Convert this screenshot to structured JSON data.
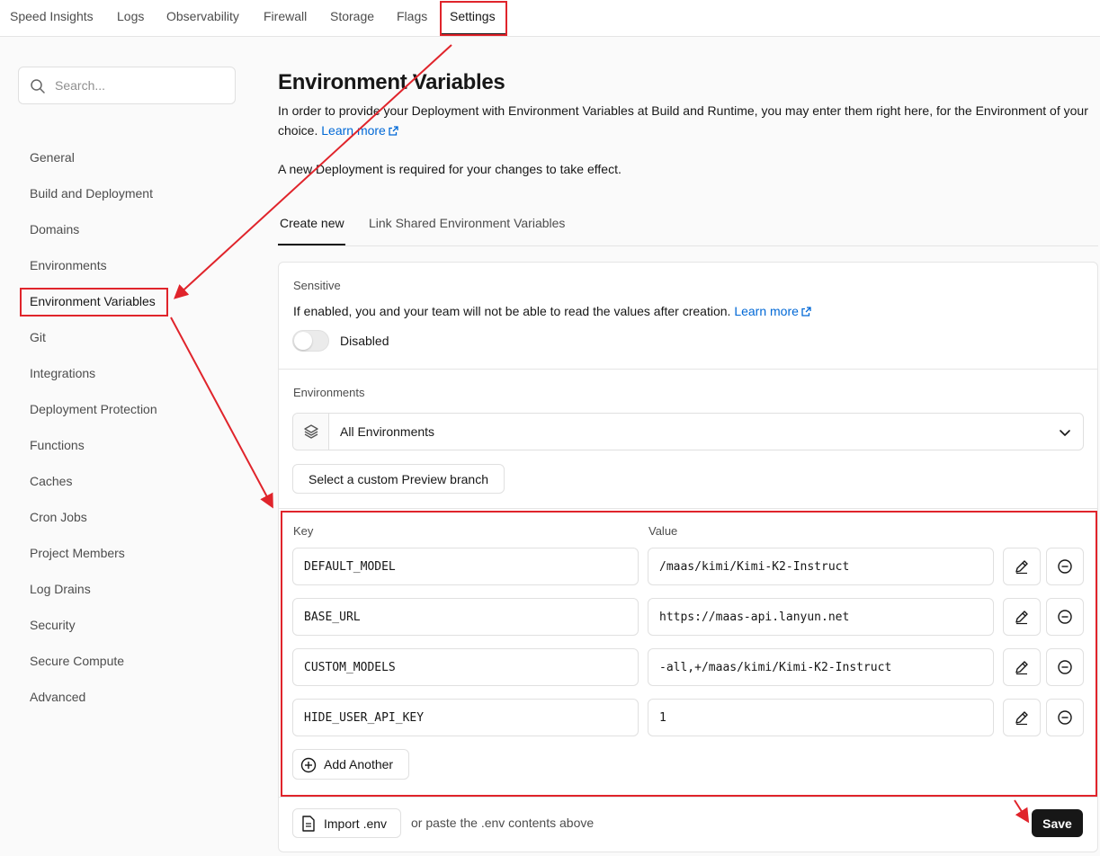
{
  "top_nav": {
    "tabs": [
      "Speed Insights",
      "Logs",
      "Observability",
      "Firewall",
      "Storage",
      "Flags",
      "Settings"
    ],
    "active": "Settings"
  },
  "sidebar": {
    "search_placeholder": "Search...",
    "items": [
      "General",
      "Build and Deployment",
      "Domains",
      "Environments",
      "Environment Variables",
      "Git",
      "Integrations",
      "Deployment Protection",
      "Functions",
      "Caches",
      "Cron Jobs",
      "Project Members",
      "Log Drains",
      "Security",
      "Secure Compute",
      "Advanced"
    ],
    "active": "Environment Variables"
  },
  "main": {
    "title": "Environment Variables",
    "description": "In order to provide your Deployment with Environment Variables at Build and Runtime, you may enter them right here, for the Environment of your choice.",
    "learn_more": "Learn more",
    "note": "A new Deployment is required for your changes to take effect.",
    "tabs": [
      "Create new",
      "Link Shared Environment Variables"
    ],
    "active_tab": "Create new",
    "sensitive": {
      "label": "Sensitive",
      "description": "If enabled, you and your team will not be able to read the values after creation.",
      "learn_more": "Learn more",
      "toggle_state": "Disabled"
    },
    "environments": {
      "label": "Environments",
      "selected": "All Environments",
      "custom_branch_button": "Select a custom Preview branch"
    },
    "variables": {
      "key_header": "Key",
      "value_header": "Value",
      "rows": [
        {
          "key": "DEFAULT_MODEL",
          "value": "/maas/kimi/Kimi-K2-Instruct"
        },
        {
          "key": "BASE_URL",
          "value": "https://maas-api.lanyun.net"
        },
        {
          "key": "CUSTOM_MODELS",
          "value": "-all,+/maas/kimi/Kimi-K2-Instruct"
        },
        {
          "key": "HIDE_USER_API_KEY",
          "value": "1"
        }
      ],
      "add_another": "Add Another"
    },
    "footer": {
      "import_button": "Import .env",
      "hint": "or paste the .env contents above",
      "save_button": "Save"
    }
  },
  "colors": {
    "accent_link": "#0068d6",
    "annotation": "#e0242b",
    "primary_button": "#171717"
  }
}
